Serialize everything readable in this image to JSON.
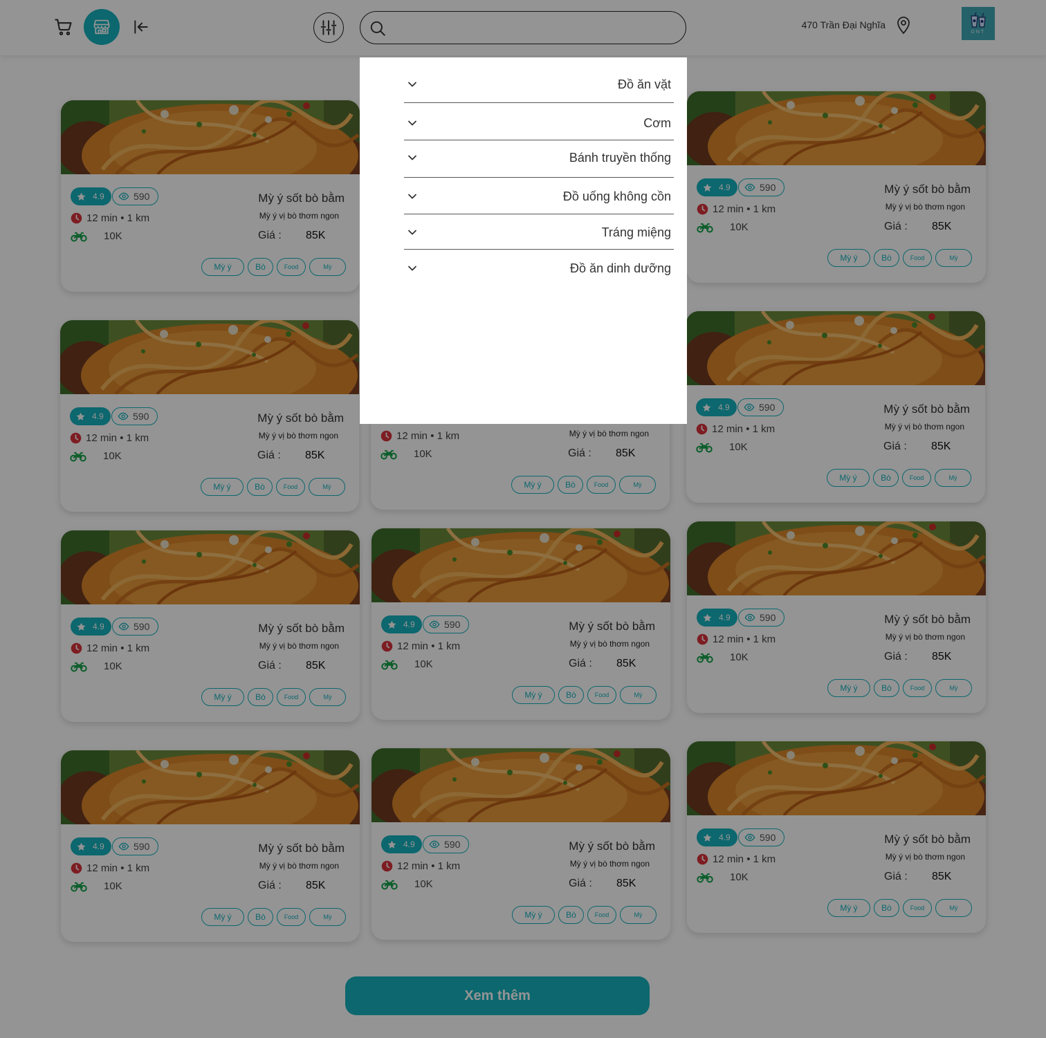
{
  "header": {
    "search_placeholder": "",
    "address": "470 Trần Đại Nghĩa",
    "logo_text": "DNT",
    "icons": [
      "cart-icon",
      "store-icon",
      "logout-icon",
      "filter-icon",
      "search-icon",
      "location-pin-icon"
    ]
  },
  "colors": {
    "accent": "#16b1bd",
    "rating_star": "#ffffff",
    "clock": "#d8323b",
    "bike": "#15a34a"
  },
  "card_template": {
    "rating": "4.9",
    "views": "590",
    "time": "12 min • 1 km",
    "ship_fee": "10K",
    "name": "Mỳ ý sốt bò bằm",
    "description": "Mỳ ý vị bò thơm ngon",
    "price_label": "Giá :",
    "price": "85K",
    "tags": [
      "Mỳ ý",
      "Bò",
      "Food",
      "Mỳ"
    ]
  },
  "cards": [
    {
      "rating": "4.9",
      "views": "590",
      "time": "12 min • 1 km",
      "ship_fee": "10K",
      "name": "Mỳ ý sốt bò bằm",
      "description": "Mỳ ý vị bò thơm ngon",
      "price_label": "Giá :",
      "price": "85K",
      "tags": [
        "Mỳ ý",
        "Bò",
        "Food",
        "Mỳ"
      ]
    },
    {
      "rating": "4.9",
      "views": "590",
      "time": "12 min • 1 km",
      "ship_fee": "10K",
      "name": "Mỳ ý sốt bò bằm",
      "description": "Mỳ ý vị bò thơm ngon",
      "price_label": "Giá :",
      "price": "85K",
      "tags": [
        "Mỳ ý",
        "Bò",
        "Food",
        "Mỳ"
      ]
    },
    {
      "rating": "4.9",
      "views": "590",
      "time": "12 min • 1 km",
      "ship_fee": "10K",
      "name": "Mỳ ý sốt bò bằm",
      "description": "Mỳ ý vị bò thơm ngon",
      "price_label": "Giá :",
      "price": "85K",
      "tags": [
        "Mỳ ý",
        "Bò",
        "Food",
        "Mỳ"
      ]
    },
    {
      "rating": "4.9",
      "views": "590",
      "time": "12 min • 1 km",
      "ship_fee": "10K",
      "name": "Mỳ ý sốt bò bằm",
      "description": "Mỳ ý vị bò thơm ngon",
      "price_label": "Giá :",
      "price": "85K",
      "tags": [
        "Mỳ ý",
        "Bò",
        "Food",
        "Mỳ"
      ]
    },
    {
      "rating": "4.9",
      "views": "590",
      "time": "12 min • 1 km",
      "ship_fee": "10K",
      "name": "Mỳ ý sốt bò bằm",
      "description": "Mỳ ý vị bò thơm ngon",
      "price_label": "Giá :",
      "price": "85K",
      "tags": [
        "Mỳ ý",
        "Bò",
        "Food",
        "Mỳ"
      ]
    },
    {
      "rating": "4.9",
      "views": "590",
      "time": "12 min • 1 km",
      "ship_fee": "10K",
      "name": "Mỳ ý sốt bò bằm",
      "description": "Mỳ ý vị bò thơm ngon",
      "price_label": "Giá :",
      "price": "85K",
      "tags": [
        "Mỳ ý",
        "Bò",
        "Food",
        "Mỳ"
      ]
    },
    {
      "rating": "4.9",
      "views": "590",
      "time": "12 min • 1 km",
      "ship_fee": "10K",
      "name": "Mỳ ý sốt bò bằm",
      "description": "Mỳ ý vị bò thơm ngon",
      "price_label": "Giá :",
      "price": "85K",
      "tags": [
        "Mỳ ý",
        "Bò",
        "Food",
        "Mỳ"
      ]
    },
    {
      "rating": "4.9",
      "views": "590",
      "time": "12 min • 1 km",
      "ship_fee": "10K",
      "name": "Mỳ ý sốt bò bằm",
      "description": "Mỳ ý vị bò thơm ngon",
      "price_label": "Giá :",
      "price": "85K",
      "tags": [
        "Mỳ ý",
        "Bò",
        "Food",
        "Mỳ"
      ]
    },
    {
      "rating": "4.9",
      "views": "590",
      "time": "12 min • 1 km",
      "ship_fee": "10K",
      "name": "Mỳ ý sốt bò bằm",
      "description": "Mỳ ý vị bò thơm ngon",
      "price_label": "Giá :",
      "price": "85K",
      "tags": [
        "Mỳ ý",
        "Bò",
        "Food",
        "Mỳ"
      ]
    },
    {
      "rating": "4.9",
      "views": "590",
      "time": "12 min • 1 km",
      "ship_fee": "10K",
      "name": "Mỳ ý sốt bò bằm",
      "description": "Mỳ ý vị bò thơm ngon",
      "price_label": "Giá :",
      "price": "85K",
      "tags": [
        "Mỳ ý",
        "Bò",
        "Food",
        "Mỳ"
      ]
    },
    {
      "rating": "4.9",
      "views": "590",
      "time": "12 min • 1 km",
      "ship_fee": "10K",
      "name": "Mỳ ý sốt bò bằm",
      "description": "Mỳ ý vị bò thơm ngon",
      "price_label": "Giá :",
      "price": "85K",
      "tags": [
        "Mỳ ý",
        "Bò",
        "Food",
        "Mỳ"
      ]
    },
    {
      "rating": "4.9",
      "views": "590",
      "time": "12 min • 1 km",
      "ship_fee": "10K",
      "name": "Mỳ ý sốt bò bằm",
      "description": "Mỳ ý vị bò thơm ngon",
      "price_label": "Giá :",
      "price": "85K",
      "tags": [
        "Mỳ ý",
        "Bò",
        "Food",
        "Mỳ"
      ]
    }
  ],
  "load_more_label": "Xem thêm",
  "categories": [
    {
      "label": "Đồ ăn vặt"
    },
    {
      "label": "Cơm"
    },
    {
      "label": "Bánh truyền thống"
    },
    {
      "label": "Đồ uống không cồn"
    },
    {
      "label": "Tráng miệng"
    },
    {
      "label": "Đồ ăn dinh dưỡng"
    }
  ]
}
